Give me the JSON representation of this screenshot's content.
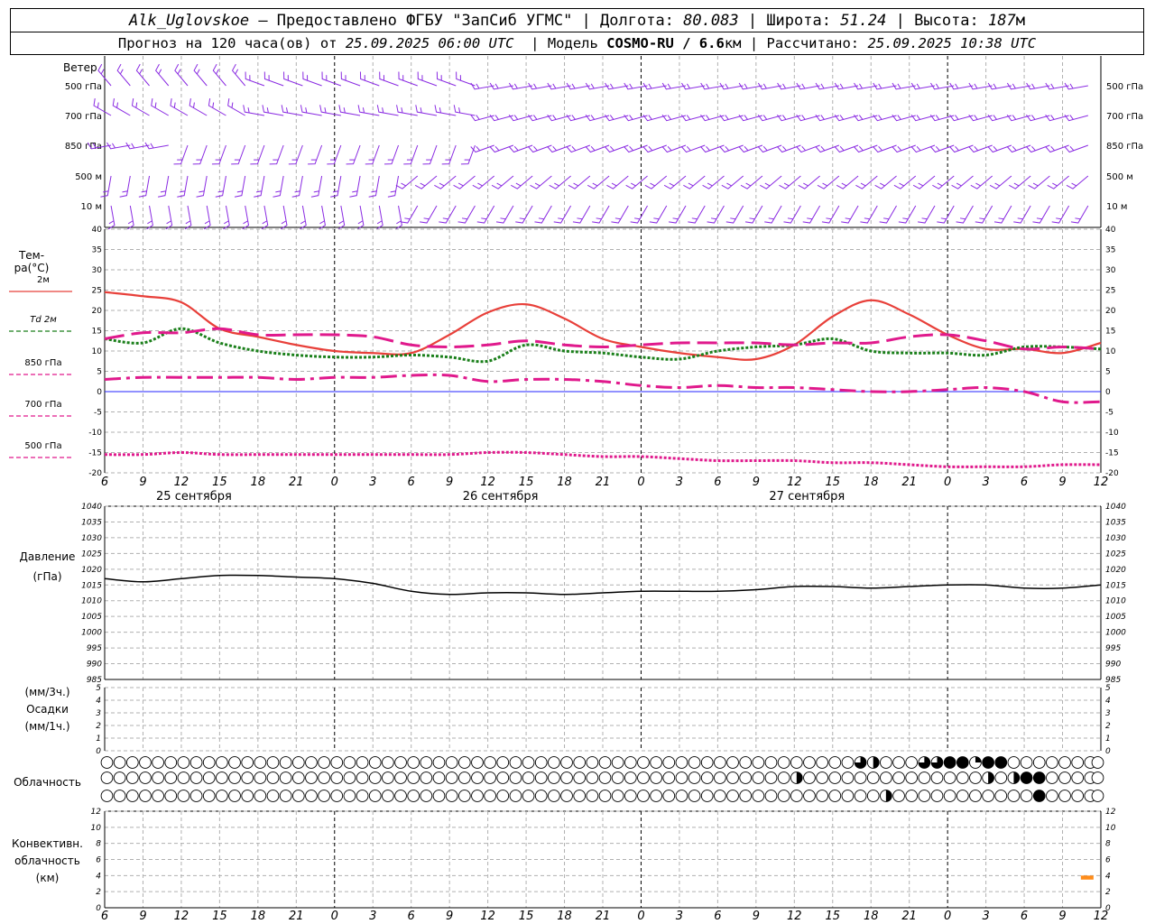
{
  "header": {
    "station": "Alk_Uglovskoe",
    "provider": "– Предоставлено ФГБУ \"ЗапСиб УГМС\" |",
    "lon_label": "Долгота:",
    "lon_value": "80.083",
    "lat_label": "| Широта:",
    "lat_value": "51.24",
    "alt_label": "| Высота:",
    "alt_value": "187",
    "alt_unit": "м",
    "forecast_prefix": "Прогноз на 120 часа(ов) от",
    "forecast_time": "25.09.2025 06:00 UTC",
    "model_label": "| Модель",
    "model_name": "COSMO-RU / 6.6",
    "model_unit": "км",
    "calc_label": "| Рассчитано:",
    "calc_time": "25.09.2025 10:38 UTC"
  },
  "labels": {
    "wind": "Ветер",
    "wind_levels": [
      "500 гПа",
      "700 гПа",
      "850 гПа",
      "500 м",
      "10 м"
    ],
    "temp": "Тем-ра(°C)",
    "temp_legend": [
      "2м",
      "Td 2м",
      "850 гПа",
      "700 гПа",
      "500 гПа"
    ],
    "pressure_1": "Давление",
    "pressure_2": "(гПа)",
    "precip_1": "(мм/3ч.)",
    "precip_2": "Осадки",
    "precip_3": "(мм/1ч.)",
    "cloud": "Облачность",
    "conv_1": "Конвективн.",
    "conv_2": "облачность",
    "conv_3": "(км)"
  },
  "colors": {
    "wind": "#8a2be2",
    "t2m": "#e8403a",
    "td2m": "#1a7f1a",
    "t850": "#e0198c",
    "t700": "#e0198c",
    "t500": "#e0198c",
    "zero": "#2323ff",
    "pressure": "#000000",
    "convective": "#ff8c1a"
  },
  "chart_data": [
    {
      "type": "line",
      "title": "Тем-ра(°C)",
      "time_ticks": [
        "6",
        "9",
        "12",
        "15",
        "18",
        "21",
        "0",
        "3",
        "6",
        "9",
        "12",
        "15",
        "18",
        "21",
        "0",
        "3",
        "6",
        "9",
        "12",
        "15",
        "18",
        "21",
        "0",
        "3",
        "6",
        "9",
        "12"
      ],
      "day_labels": [
        "25 сентября",
        "26 сентября",
        "27 сентября"
      ],
      "ylim": [
        -20,
        40
      ],
      "yticks": [
        -20,
        -15,
        -10,
        -5,
        0,
        5,
        10,
        15,
        20,
        25,
        30,
        35,
        40
      ],
      "x": [
        0,
        3,
        6,
        9,
        12,
        15,
        18,
        21,
        24,
        27,
        30,
        33,
        36,
        39,
        42,
        45,
        48,
        51,
        54,
        57,
        60,
        63,
        66,
        69,
        72,
        75,
        78
      ],
      "series": [
        {
          "name": "2м",
          "values": [
            24.5,
            23.5,
            22,
            15.5,
            13.5,
            11.5,
            10,
            9.5,
            9.5,
            14,
            19.5,
            21.5,
            18,
            13,
            11,
            9.5,
            8.5,
            8,
            11.5,
            18.5,
            22.5,
            19,
            14,
            10.5,
            10.5,
            9.5,
            12
          ]
        },
        {
          "name": "Td 2м",
          "values": [
            13,
            12,
            15.5,
            12,
            10,
            9,
            8.5,
            8.5,
            9,
            8.5,
            7.5,
            11.5,
            10,
            9.5,
            8.5,
            8,
            10,
            11,
            11.5,
            13,
            10,
            9.5,
            9.5,
            9,
            11,
            11,
            10.5
          ]
        },
        {
          "name": "850 гПа",
          "values": [
            13,
            14.5,
            14.5,
            15.5,
            14,
            14,
            14,
            13.5,
            11.5,
            11,
            11.5,
            12.5,
            11.5,
            11,
            11.5,
            12,
            12,
            12,
            11.5,
            12,
            12,
            13.5,
            14,
            12.5,
            10.5,
            11,
            10.5
          ]
        },
        {
          "name": "700 гПа",
          "values": [
            3,
            3.5,
            3.5,
            3.5,
            3.5,
            3,
            3.5,
            3.5,
            4,
            4,
            2.5,
            3,
            3,
            2.5,
            1.5,
            1,
            1.5,
            1,
            1,
            0.5,
            0,
            0,
            0.5,
            1,
            0,
            -2.5,
            -2.5
          ]
        },
        {
          "name": "500 гПа",
          "values": [
            -15.5,
            -15.5,
            -15,
            -15.5,
            -15.5,
            -15.5,
            -15.5,
            -15.5,
            -15.5,
            -15.5,
            -15,
            -15,
            -15.5,
            -16,
            -16,
            -16.5,
            -17,
            -17,
            -17,
            -17.5,
            -17.5,
            -18,
            -18.5,
            -18.5,
            -18.5,
            -18,
            -18
          ]
        }
      ]
    },
    {
      "type": "line",
      "title": "Давление (гПа)",
      "ylim": [
        985,
        1040
      ],
      "yticks": [
        985,
        990,
        995,
        1000,
        1005,
        1010,
        1015,
        1020,
        1025,
        1030,
        1035,
        1040
      ],
      "x": [
        0,
        3,
        6,
        9,
        12,
        15,
        18,
        21,
        24,
        27,
        30,
        33,
        36,
        39,
        42,
        45,
        48,
        51,
        54,
        57,
        60,
        63,
        66,
        69,
        72,
        75,
        78
      ],
      "series": [
        {
          "name": "Давление",
          "values": [
            1017,
            1016,
            1017,
            1018,
            1018,
            1017.5,
            1017,
            1015.5,
            1013,
            1012,
            1012.5,
            1012.5,
            1012,
            1012.5,
            1013,
            1013,
            1013,
            1013.5,
            1014.5,
            1014.5,
            1014,
            1014.5,
            1015,
            1015,
            1014,
            1014,
            1015
          ]
        }
      ]
    },
    {
      "type": "bar",
      "title": "Осадки",
      "ylim": [
        0,
        5
      ],
      "yticks": [
        0,
        1,
        2,
        3,
        4,
        5
      ],
      "values": []
    },
    {
      "type": "bar",
      "title": "Конвективн. облачность (км)",
      "ylim": [
        0,
        12
      ],
      "yticks": [
        0,
        2,
        4,
        6,
        8,
        10,
        12
      ],
      "series": [
        {
          "x": 77,
          "values": [
            3.5,
            4
          ]
        }
      ]
    }
  ],
  "cloud_rows": {
    "row1": "000000000000000000000000000000000000000000000000000000000000000000000000000000000000000000000000000000000003000000000030200003013434434212444",
    "row2": "000000000000000000000000000000000000000000000000000000000000000000000000000000000000000000000000000000000000200000000200000000000000000002220324444",
    "row3": "000000000000000000000000000000000000000000000000000000000000000000000000000000000000000000000000000000000000000000000000002000000000000000000000044000000000"
  }
}
